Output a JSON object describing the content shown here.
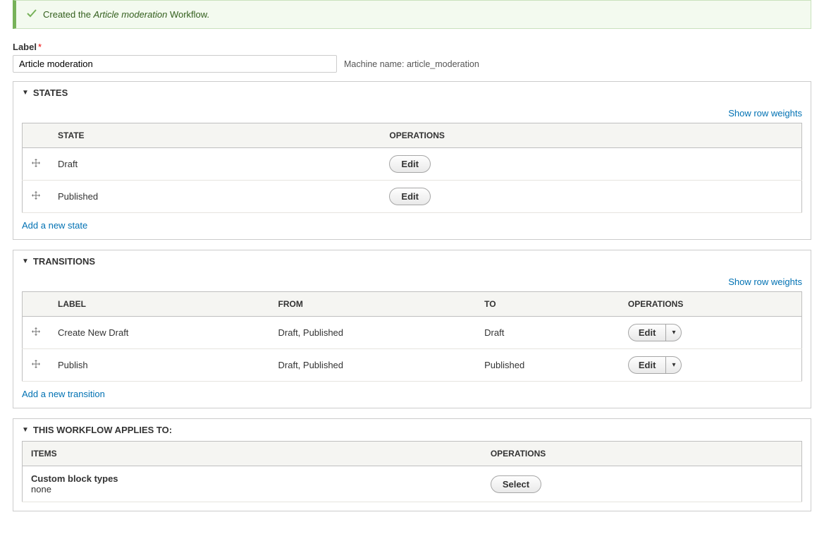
{
  "message": {
    "prefix": "Created the ",
    "emph": "Article moderation",
    "suffix": " Workflow."
  },
  "label_section": {
    "label": "Label",
    "value": "Article moderation",
    "machine_name_label": "Machine name:",
    "machine_name_value": "article_moderation"
  },
  "states": {
    "title": "States",
    "show_weights": "Show row weights",
    "headers": {
      "state": "State",
      "operations": "Operations"
    },
    "rows": [
      {
        "state": "Draft",
        "op": "Edit"
      },
      {
        "state": "Published",
        "op": "Edit"
      }
    ],
    "add_link": "Add a new state"
  },
  "transitions": {
    "title": "Transitions",
    "show_weights": "Show row weights",
    "headers": {
      "label": "Label",
      "from": "From",
      "to": "To",
      "operations": "Operations"
    },
    "rows": [
      {
        "label": "Create New Draft",
        "from": "Draft, Published",
        "to": "Draft",
        "op": "Edit"
      },
      {
        "label": "Publish",
        "from": "Draft, Published",
        "to": "Published",
        "op": "Edit"
      }
    ],
    "add_link": "Add a new transition"
  },
  "applies_to": {
    "title": "This workflow applies to:",
    "headers": {
      "items": "Items",
      "operations": "Operations"
    },
    "rows": [
      {
        "item_title": "Custom block types",
        "item_sub": "none",
        "op": "Select"
      }
    ]
  }
}
